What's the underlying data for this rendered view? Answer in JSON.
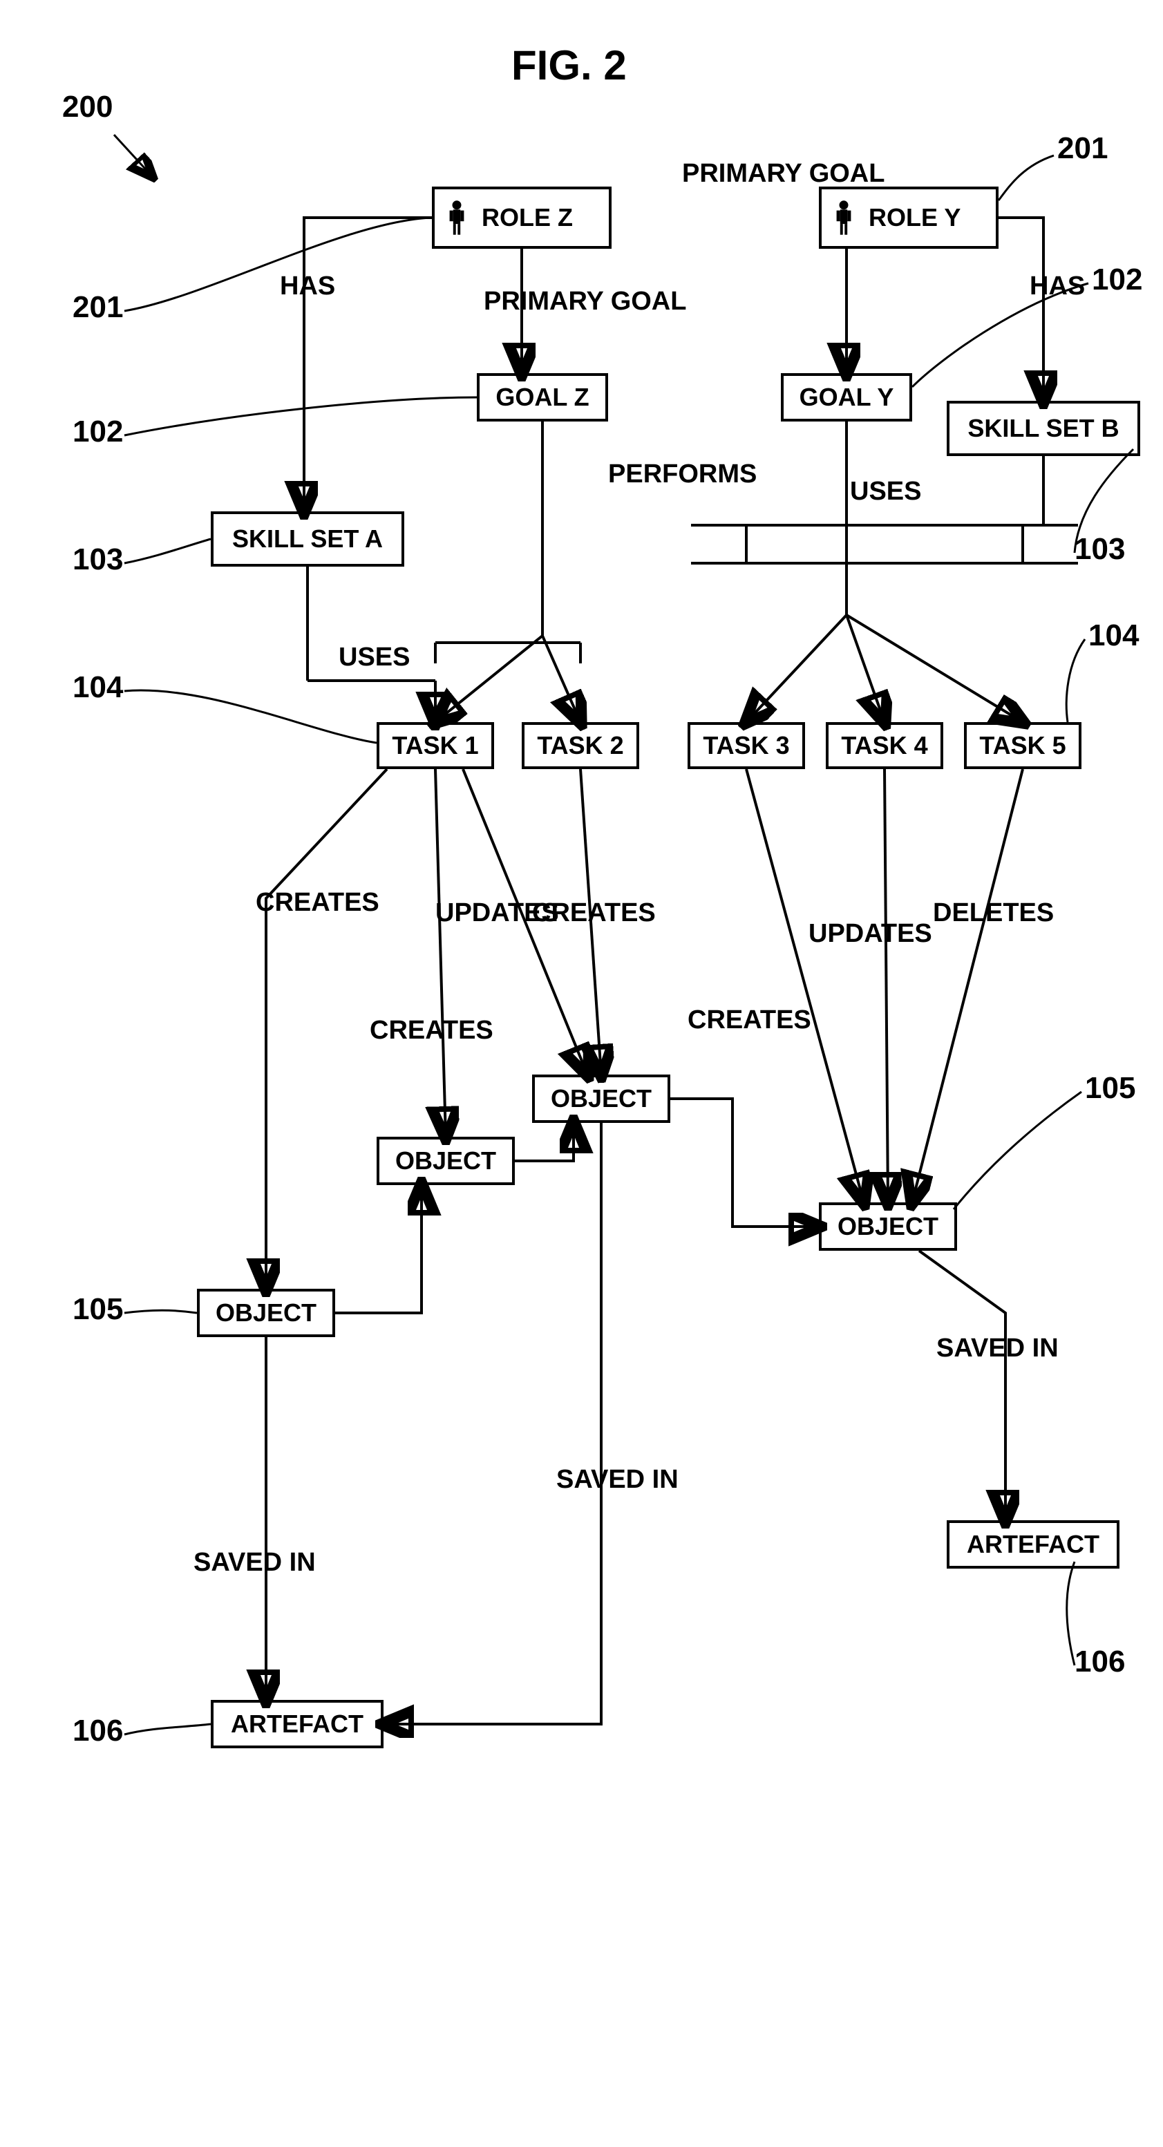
{
  "figure": {
    "title": "FIG. 2",
    "ref_id": "200"
  },
  "refs": {
    "r201": "201",
    "r102": "102",
    "r103": "103",
    "r104": "104",
    "r105": "105",
    "r106": "106"
  },
  "roles": {
    "z": {
      "label": "ROLE Z"
    },
    "y": {
      "label": "ROLE Y"
    }
  },
  "goals": {
    "z": {
      "label": "GOAL Z"
    },
    "y": {
      "label": "GOAL Y"
    }
  },
  "skillsets": {
    "a": {
      "label": "SKILL SET A"
    },
    "b": {
      "label": "SKILL SET B"
    }
  },
  "tasks": {
    "t1": "TASK 1",
    "t2": "TASK 2",
    "t3": "TASK 3",
    "t4": "TASK 4",
    "t5": "TASK 5"
  },
  "objects": {
    "o1": "OBJECT",
    "o2": "OBJECT",
    "o3": "OBJECT",
    "o4": "OBJECT"
  },
  "artefacts": {
    "a1": "ARTEFACT",
    "a2": "ARTEFACT"
  },
  "edge_labels": {
    "has": "HAS",
    "primary_goal": "PRIMARY GOAL",
    "performs": "PERFORMS",
    "uses": "USES",
    "creates": "CREATES",
    "updates": "UPDATES",
    "deletes": "DELETES",
    "saved_in": "SAVED IN"
  }
}
